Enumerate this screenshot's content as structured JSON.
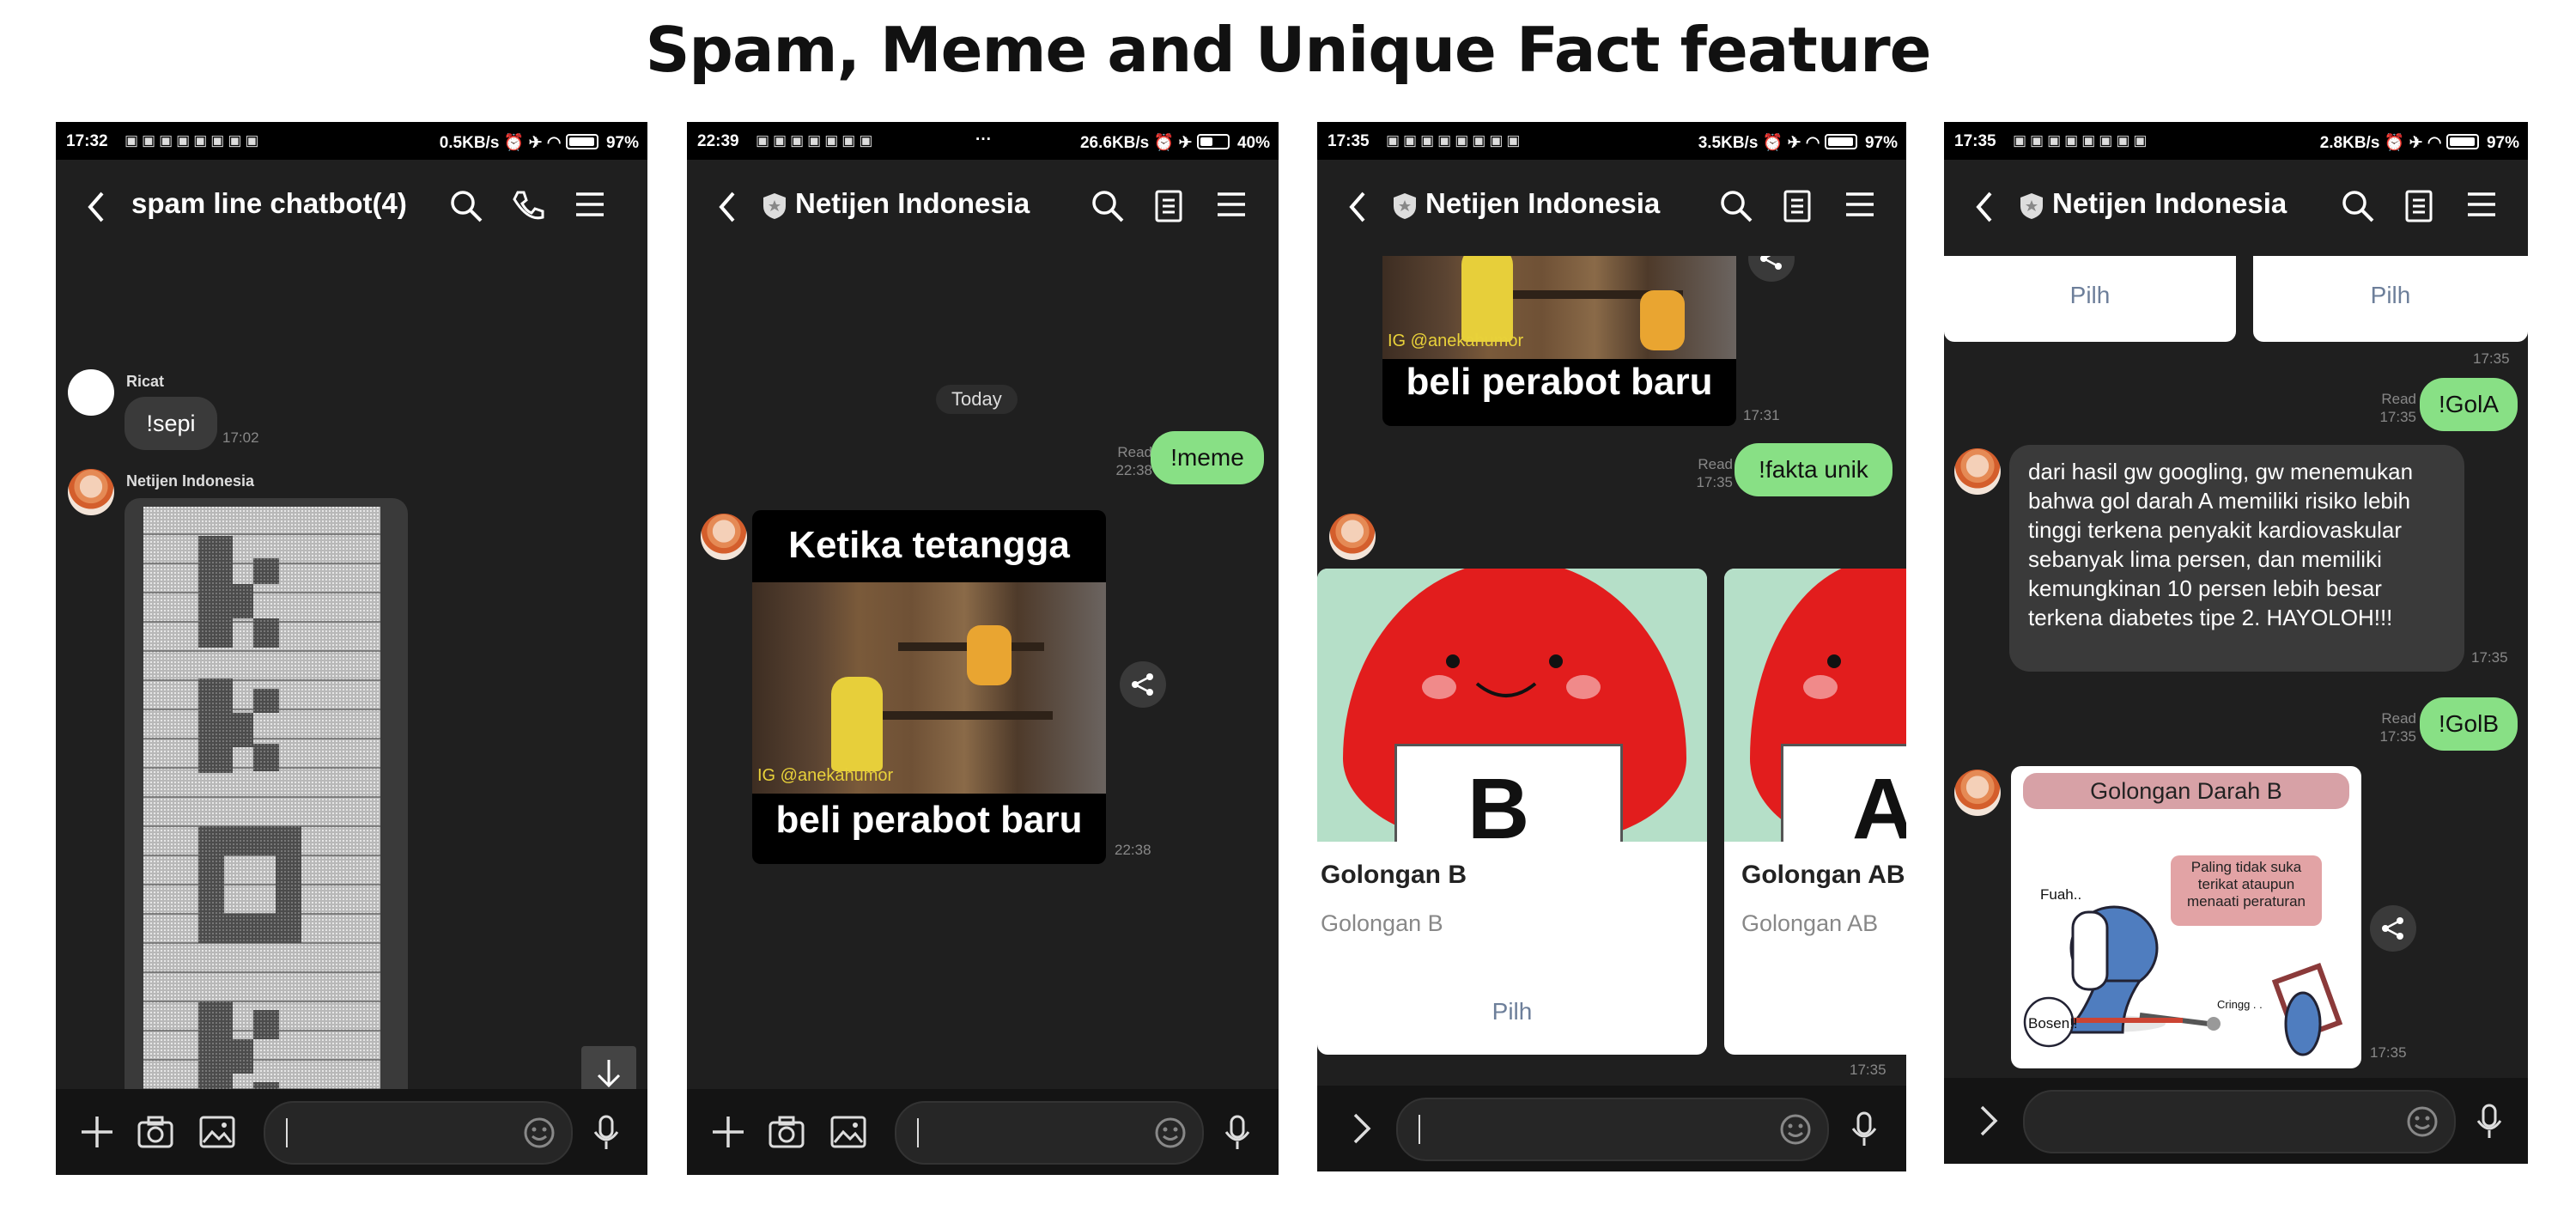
{
  "title": "Spam, Meme and Unique Fact feature",
  "phones": [
    {
      "status": {
        "time": "17:32",
        "network": "0.5KB/s",
        "battery": "97%",
        "battery_level": 0.97
      },
      "header": {
        "title": "spam line chatbot(4)"
      },
      "messages": [
        {
          "sender": "Ricat",
          "text": "!sepi",
          "time": "17:02"
        },
        {
          "sender": "Netijen Indonesia",
          "content": "spam-pattern-image"
        }
      ]
    },
    {
      "status": {
        "time": "22:39",
        "network": "26.6KB/s",
        "battery": "40%",
        "battery_level": 0.4,
        "extra": "···"
      },
      "header": {
        "title": "Netijen Indonesia"
      },
      "date_chip": "Today",
      "outgoing": {
        "text": "!meme",
        "read": "Read",
        "time": "22:38"
      },
      "meme": {
        "top": "Ketika tetangga",
        "bottom": "beli perabot baru",
        "watermark": "IG @anekahumor",
        "time": "22:38"
      }
    },
    {
      "status": {
        "time": "17:35",
        "network": "3.5KB/s",
        "battery": "97%",
        "battery_level": 0.97
      },
      "header": {
        "title": "Netijen Indonesia"
      },
      "meme": {
        "bottom": "beli perabot baru",
        "watermark": "IG @anekahumor",
        "time": "17:31"
      },
      "outgoing": {
        "text": "!fakta unik",
        "read": "Read",
        "time": "17:35"
      },
      "cards": [
        {
          "title": "Golongan B",
          "subtitle": "Golongan B",
          "action": "Pilh",
          "letter": "B"
        },
        {
          "title": "Golongan AB",
          "subtitle": "Golongan AB",
          "letter": "A"
        }
      ],
      "carousel_time": "17:35"
    },
    {
      "status": {
        "time": "17:35",
        "network": "2.8KB/s",
        "battery": "97%",
        "battery_level": 0.97
      },
      "header": {
        "title": "Netijen Indonesia"
      },
      "top_cards": [
        {
          "action": "Pilh"
        },
        {
          "action": "Pilh"
        }
      ],
      "top_time": "17:35",
      "out1": {
        "text": "!GolA",
        "read": "Read",
        "time": "17:35"
      },
      "fact": {
        "text": "dari hasil gw googling, gw menemukan bahwa gol darah A memiliki risiko lebih tinggi terkena penyakit kardiovaskular sebanyak lima persen, dan memiliki kemungkinan 10 persen lebih besar terkena diabetes tipe 2. HAYOLOH!!!",
        "time": "17:35"
      },
      "out2": {
        "text": "!GolB",
        "read": "Read",
        "time": "17:35"
      },
      "image": {
        "title": "Golongan Darah B",
        "speech": "Paling tidak suka terikat ataupun menaati peraturan",
        "fuah": "Fuah..",
        "bosen": "Bosen!!",
        "cringg": "Cringg . .",
        "time": "17:35"
      }
    }
  ]
}
